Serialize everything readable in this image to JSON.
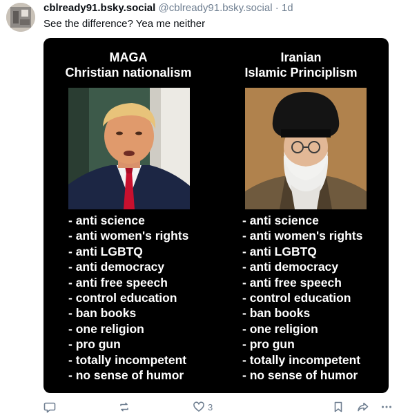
{
  "post": {
    "display_name": "cblready91.bsky.social",
    "handle": "@cblready91.bsky.social",
    "separator": "·",
    "time": "1d",
    "text": "See the difference?  Yea me neither"
  },
  "embed": {
    "left": {
      "title_line1": "MAGA",
      "title_line2": "Christian nationalism",
      "items": [
        "- anti science",
        "- anti women's rights",
        "- anti LGBTQ",
        "- anti democracy",
        "- anti free speech",
        "- control education",
        "- ban books",
        "- one religion",
        "- pro gun",
        "- totally incompetent",
        "- no sense of humor"
      ]
    },
    "right": {
      "title_line1": "Iranian",
      "title_line2": "Islamic Principlism",
      "items": [
        "- anti science",
        "- anti women's rights",
        "- anti LGBTQ",
        "- anti democracy",
        "- anti free speech",
        "- control education",
        "- ban books",
        "- one religion",
        "- pro gun",
        "- totally incompetent",
        "- no sense of humor"
      ]
    }
  },
  "actions": {
    "reply_icon": "reply-icon",
    "repost_icon": "repost-icon",
    "like_icon": "heart-icon",
    "like_count": "3",
    "bookmark_icon": "bookmark-icon",
    "share_icon": "share-icon",
    "more_icon": "more-icon"
  },
  "colors": {
    "text": "#0b0f14",
    "muted": "#6f7f91",
    "accent": "#1083fe",
    "embed_bg": "#000000"
  }
}
